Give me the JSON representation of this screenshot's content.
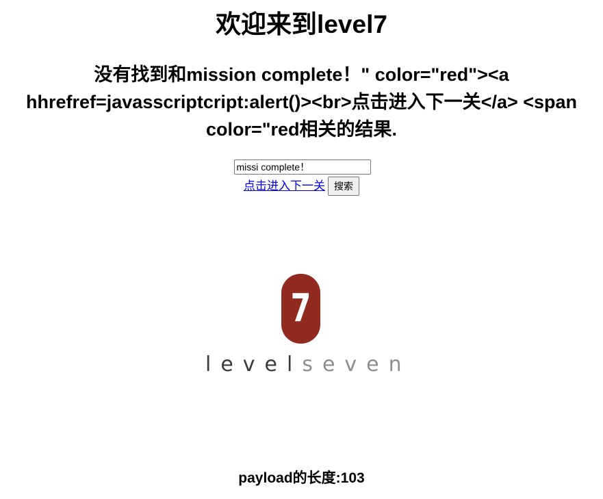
{
  "page": {
    "title": "欢迎来到level7",
    "result_message": "没有找到和mission complete！\" color=\"red\"><a hhrefref=javasscriptcript:alert()><br>点击进入下一关</a> <span color=\"red相关的结果."
  },
  "search": {
    "input_value": "missi complete！",
    "link_text": "点击进入下一关",
    "button_label": "搜索"
  },
  "logo": {
    "badge_digit": "7",
    "word_level": "level",
    "word_seven": "seven",
    "badge_color": "#912a1f",
    "level_color": "#3a3a3a",
    "seven_color": "#8e8e8e"
  },
  "footer": {
    "payload_length": "payload的长度:103"
  }
}
